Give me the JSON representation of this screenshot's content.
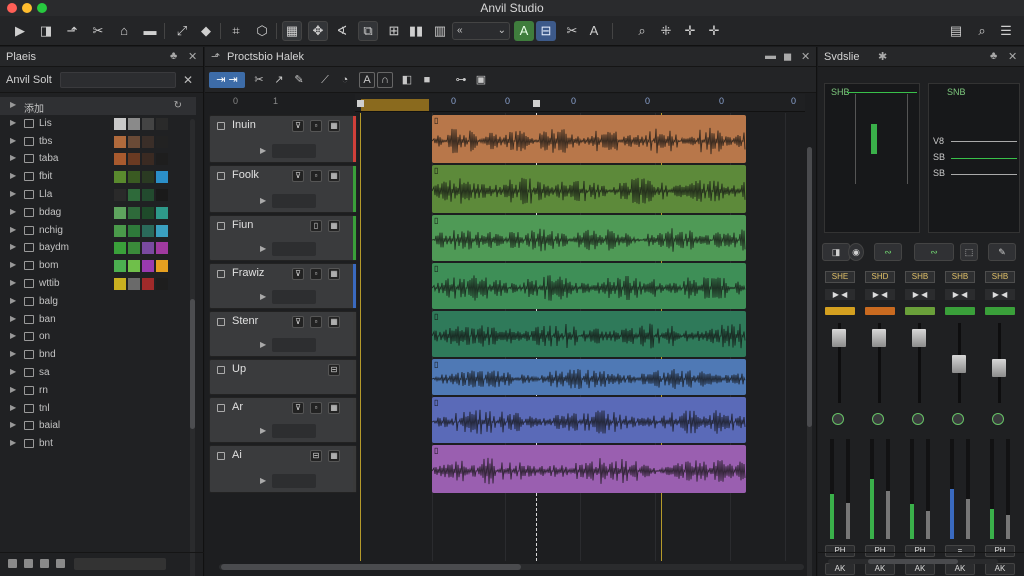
{
  "app": {
    "title": "Anvil Studio"
  },
  "toolbar": {
    "buttons": [
      "pointer-icon",
      "select-icon",
      "range-icon",
      "split-icon",
      "erase-icon",
      "draw-icon",
      "zoom-icon",
      "crop-icon",
      "shield-icon",
      "grid-icon",
      "loop-icon",
      "marker-icon",
      "mute-icon",
      "pause-icon",
      "bars-icon",
      "snap-icon",
      "volume-icon",
      "automation-icon",
      "auto-read-icon",
      "key-icon",
      "edit-icon",
      "search-icon",
      "expand-icon",
      "shrink-icon",
      "fit-icon",
      "window-icon",
      "settings-search-icon",
      "menu-icon"
    ],
    "snap_value": "«"
  },
  "browser": {
    "title": "Plaeis",
    "search_label": "Anvil Solt",
    "search_value": "",
    "items": [
      {
        "label": "添加",
        "selected": true,
        "swatches": []
      },
      {
        "label": "Lis",
        "swatches": [
          "#c9c9c9",
          "#8a8a8a",
          "#444444",
          "#2a2a2a"
        ]
      },
      {
        "label": "tbs",
        "swatches": [
          "#b06a3c",
          "#6a4a36",
          "#3a2e28",
          "#222222"
        ]
      },
      {
        "label": "taba",
        "swatches": [
          "#a85a2e",
          "#6a3a22",
          "#3a2a22",
          "#1e1e1e"
        ]
      },
      {
        "label": "fbit",
        "swatches": [
          "#5a8a2e",
          "#3a5a22",
          "#2a3a22",
          "#2b8fc9"
        ]
      },
      {
        "label": "Lla",
        "swatches": [
          "#2a2a2a",
          "#2e6a3a",
          "#224a2e",
          "#1a1a1a"
        ]
      },
      {
        "label": "bdag",
        "swatches": [
          "#5ea45e",
          "#2e6a3a",
          "#1e4a2a",
          "#2e9a8a"
        ]
      },
      {
        "label": "nchig",
        "swatches": [
          "#4a9a4a",
          "#2e7a3a",
          "#2a6a5a",
          "#3aa0c0"
        ]
      },
      {
        "label": "baydm",
        "swatches": [
          "#3aa03a",
          "#3a8a3a",
          "#7a4aa0",
          "#a03aa0"
        ]
      },
      {
        "label": "bom",
        "swatches": [
          "#4caf50",
          "#6fbf4a",
          "#9a3ab0",
          "#e6a020"
        ]
      },
      {
        "label": "wttib",
        "swatches": [
          "#c9b020",
          "#6a6a6a",
          "#a02a2a",
          "#1e1e1e"
        ]
      },
      {
        "label": "balg",
        "swatches": []
      },
      {
        "label": "ban",
        "swatches": []
      },
      {
        "label": "on",
        "swatches": []
      },
      {
        "label": "bnd",
        "swatches": []
      },
      {
        "label": "sa",
        "swatches": []
      },
      {
        "label": "rn",
        "swatches": []
      },
      {
        "label": "tnl",
        "swatches": []
      },
      {
        "label": "baial",
        "swatches": []
      },
      {
        "label": "bnt",
        "swatches": []
      }
    ]
  },
  "arrangement": {
    "title": "Proctsbio Halek",
    "ruler_marks": [
      "0",
      "1",
      "0",
      "0",
      "0",
      "0",
      "0",
      "0"
    ],
    "tracks": [
      {
        "name": "Inuin",
        "color": "#b8774a",
        "strip": "#d0403a"
      },
      {
        "name": "Foolk",
        "color": "#5d8a3a",
        "strip": "#3aa03a"
      },
      {
        "name": "Fiun",
        "color": "#4f9a56",
        "strip": "#3aa03a"
      },
      {
        "name": "Frawiz",
        "color": "#3e8f57",
        "strip": "#3a6ac0"
      },
      {
        "name": "Stenr",
        "color": "#2f7a5a",
        "strip": "#3a3a3a"
      },
      {
        "name": "Up",
        "color": "#4f79b5",
        "strip": "#3a3a3a"
      },
      {
        "name": "Ar",
        "color": "#5a6ab8",
        "strip": "#3a3a3a"
      },
      {
        "name": "Ai",
        "color": "#9a5fb0",
        "strip": "#3a3a3a"
      }
    ]
  },
  "mixer": {
    "title": "Svdslie",
    "scope_left_label": "SHB",
    "scope_right_label": "SNB",
    "scope_right_rows": [
      "V8",
      "SB",
      "SB"
    ],
    "channels": [
      {
        "name": "SHE",
        "mute": "▶ ◀",
        "tag": "#d4a020",
        "level": 0.88,
        "meter": 0.45,
        "meter_color": "#3ab04a",
        "btm1": "PH",
        "btm2": "AK"
      },
      {
        "name": "SHD",
        "mute": "▶ ◀",
        "tag": "#c96a20",
        "level": 0.88,
        "meter": 0.6,
        "meter_color": "#3ab04a",
        "btm1": "PH",
        "btm2": "AK"
      },
      {
        "name": "SHB",
        "mute": "▶ ◀",
        "tag": "#6aa03a",
        "level": 0.88,
        "meter": 0.35,
        "meter_color": "#3ab04a",
        "btm1": "PH",
        "btm2": "AK"
      },
      {
        "name": "SHB",
        "mute": "▶ ◀",
        "tag": "#3aa03a",
        "level": 0.55,
        "meter": 0.5,
        "meter_color": "#3a6ac0",
        "btm1": "=",
        "btm2": "AK"
      },
      {
        "name": "SHB",
        "mute": "▶ ◀",
        "tag": "#3aa03a",
        "level": 0.5,
        "meter": 0.3,
        "meter_color": "#3ab04a",
        "btm1": "PH",
        "btm2": "AK"
      }
    ]
  }
}
